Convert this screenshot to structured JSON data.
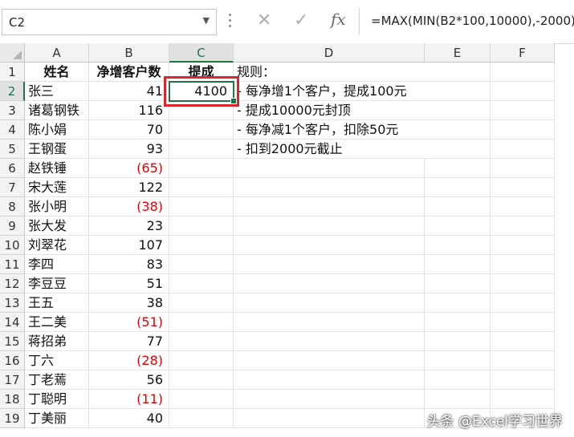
{
  "formula_bar": {
    "name_box": "C2",
    "cancel_icon": "✕",
    "enter_icon": "✓",
    "fx_label": "fx",
    "formula": "=MAX(MIN(B2*100,10000),-2000)"
  },
  "columns": [
    "A",
    "B",
    "C",
    "D",
    "E",
    "F"
  ],
  "rows": [
    "1",
    "2",
    "3",
    "4",
    "5",
    "6",
    "7",
    "8",
    "9",
    "10",
    "11",
    "12",
    "13",
    "14",
    "15",
    "16",
    "17",
    "18",
    "19"
  ],
  "headers": {
    "name": "姓名",
    "net": "净增客户数",
    "commission": "提成"
  },
  "people": [
    {
      "name": "张三",
      "value": "41",
      "neg": false
    },
    {
      "name": "诸葛钢铁",
      "value": "116",
      "neg": false
    },
    {
      "name": "陈小娟",
      "value": "70",
      "neg": false
    },
    {
      "name": "王钢蛋",
      "value": "93",
      "neg": false
    },
    {
      "name": "赵铁锤",
      "value": "(65)",
      "neg": true
    },
    {
      "name": "宋大莲",
      "value": "122",
      "neg": false
    },
    {
      "name": "张小明",
      "value": "(38)",
      "neg": true
    },
    {
      "name": "张大发",
      "value": "23",
      "neg": false
    },
    {
      "name": "刘翠花",
      "value": "107",
      "neg": false
    },
    {
      "name": "李四",
      "value": "83",
      "neg": false
    },
    {
      "name": "李豆豆",
      "value": "51",
      "neg": false
    },
    {
      "name": "王五",
      "value": "38",
      "neg": false
    },
    {
      "name": "王二美",
      "value": "(51)",
      "neg": true
    },
    {
      "name": "蒋招弟",
      "value": "77",
      "neg": false
    },
    {
      "name": "丁六",
      "value": "(28)",
      "neg": true
    },
    {
      "name": "丁老蔫",
      "value": "56",
      "neg": false
    },
    {
      "name": "丁聪明",
      "value": "(11)",
      "neg": true
    },
    {
      "name": "丁美丽",
      "value": "40",
      "neg": false
    }
  ],
  "c2_value": "4100",
  "rules": [
    "规则：",
    "- 每净增1个客户，提成100元",
    "- 提成10000元封顶",
    "- 每净减1个客户，扣除50元",
    "- 扣到2000元截止"
  ],
  "watermark": "头条 @Excel学习世界",
  "colors": {
    "accent": "#217346",
    "negative": "#e60000",
    "highlight": "#e0242b"
  }
}
